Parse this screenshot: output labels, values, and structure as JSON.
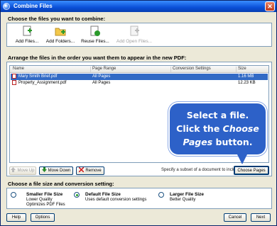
{
  "window": {
    "title": "Combine Files"
  },
  "choose_section": {
    "title": "Choose the files you want to combine:",
    "toolbar": [
      {
        "label": "Add Files...",
        "icon": "add-files-icon",
        "enabled": true
      },
      {
        "label": "Add Folders...",
        "icon": "add-folders-icon",
        "enabled": true
      },
      {
        "label": "Reuse Files...",
        "icon": "reuse-files-icon",
        "enabled": true
      },
      {
        "label": "Add Open Files...",
        "icon": "add-open-files-icon",
        "enabled": false
      }
    ]
  },
  "arrange_section": {
    "title": "Arrange the files in the order you want them to appear in the new PDF:",
    "columns": {
      "name": "Name",
      "range": "Page Range",
      "settings": "Conversion Settings",
      "size": "Size"
    },
    "rows": [
      {
        "name": "Mary Smith Brief.pdf",
        "range": "All Pages",
        "settings": "",
        "size": "1.16 MB",
        "selected": true
      },
      {
        "name": "Property_Assignment.pdf",
        "range": "All Pages",
        "settings": "",
        "size": "12.23 KB",
        "selected": false
      }
    ],
    "buttons": {
      "move_up": "Move Up",
      "move_down": "Move Down",
      "remove": "Remove",
      "choose_pages": "Choose Pages"
    },
    "subset_text": "Specify a subset of a document to include:"
  },
  "callout": {
    "line1": "Select a file.",
    "line2_a": "Click the ",
    "line2_b": "Choose",
    "line3_a": "Pages",
    "line3_b": " button."
  },
  "size_section": {
    "title": "Choose a file size and conversion setting:",
    "options": [
      {
        "title": "Smaller File Size",
        "desc1": "Lower Quality",
        "desc2": "Optimizes PDF Files",
        "selected": false
      },
      {
        "title": "Default File Size",
        "desc1": "Uses default conversion settings",
        "desc2": "",
        "selected": true
      },
      {
        "title": "Larger File Size",
        "desc1": "Better Quality",
        "desc2": "",
        "selected": false
      }
    ]
  },
  "footer": {
    "help": "Help",
    "options": "Options",
    "cancel": "Cancel",
    "next": "Next"
  },
  "colors": {
    "selection": "#316ac5",
    "titlebar": "#0a4fd8",
    "callout": "#2d61c8"
  }
}
